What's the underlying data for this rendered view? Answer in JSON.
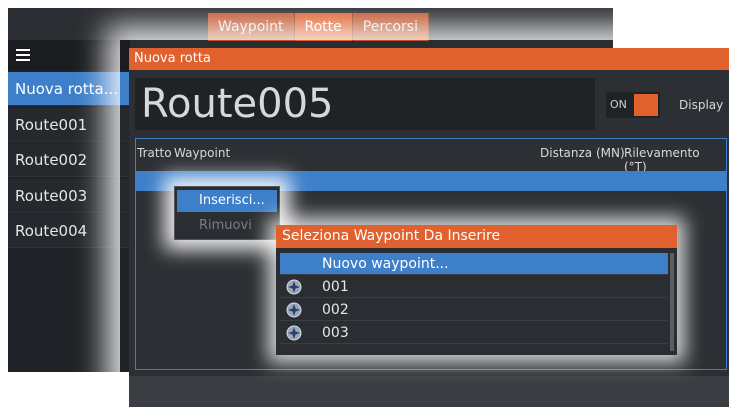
{
  "tabs": [
    {
      "label": "Waypoint",
      "active": false
    },
    {
      "label": "Rotte",
      "active": true
    },
    {
      "label": "Percorsi",
      "active": false
    }
  ],
  "sidebar": {
    "menu_icon": "hamburger-icon",
    "items": [
      {
        "label": "Nuova rotta...",
        "selected": true
      },
      {
        "label": "Route001",
        "selected": false
      },
      {
        "label": "Route002",
        "selected": false
      },
      {
        "label": "Route003",
        "selected": false
      },
      {
        "label": "Route004",
        "selected": false
      }
    ]
  },
  "dialog": {
    "title": "Nuova rotta",
    "route_name": "Route005",
    "toggle_label": "ON",
    "display_label": "Display",
    "columns": {
      "leg": "Tratto",
      "waypoint": "Waypoint",
      "distance": "Distanza (MN)",
      "bearing": "Rilevamento (°T)"
    }
  },
  "context_menu": {
    "insert": "Inserisci...",
    "remove": "Rimuovi"
  },
  "picker": {
    "title": "Seleziona Waypoint Da Inserire",
    "items": [
      {
        "label": "Nuovo waypoint...",
        "selected": true,
        "icon": ""
      },
      {
        "label": "001",
        "selected": false,
        "icon": "waypoint-icon"
      },
      {
        "label": "002",
        "selected": false,
        "icon": "waypoint-icon"
      },
      {
        "label": "003",
        "selected": false,
        "icon": "waypoint-icon"
      }
    ]
  },
  "colors": {
    "accent": "#e0612e",
    "selection": "#3d7fc9",
    "panel": "#2c2f33"
  }
}
